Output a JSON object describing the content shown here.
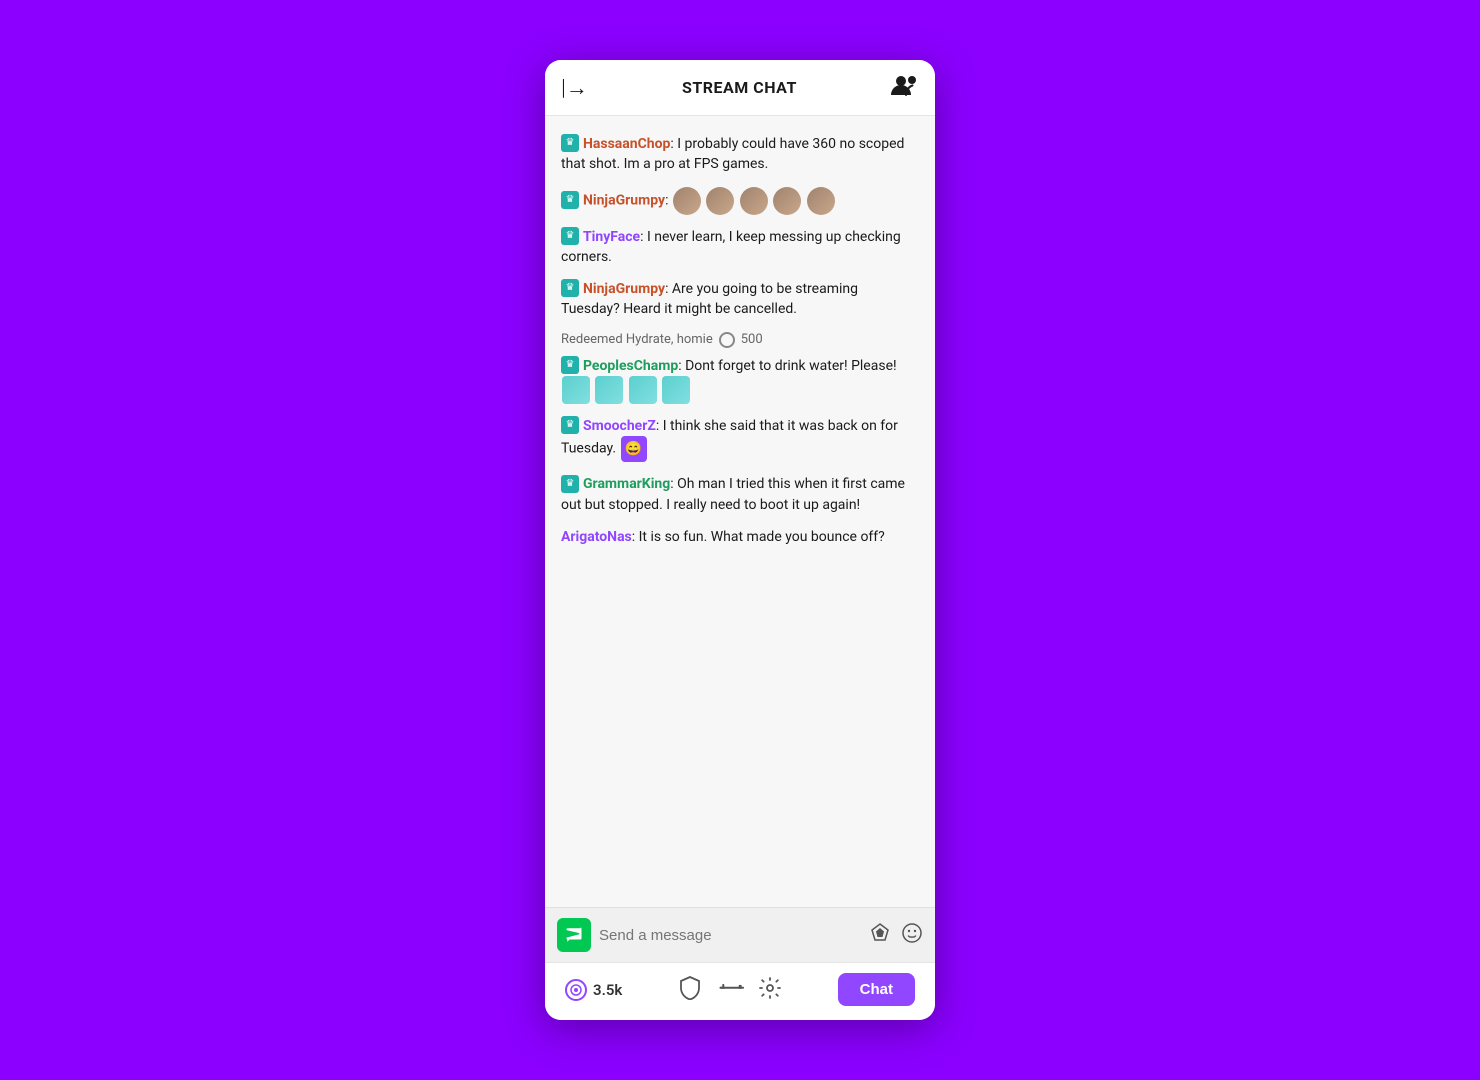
{
  "header": {
    "title": "STREAM CHAT",
    "back_icon": "→",
    "users_icon": "👥"
  },
  "messages": [
    {
      "id": 1,
      "username": "HassaanChop",
      "username_color": "orange",
      "has_badge": true,
      "text": ": I probably could have 360 no scoped that shot. Im a pro at FPS games.",
      "has_emotes": false
    },
    {
      "id": 2,
      "username": "NinjaGrumpy",
      "username_color": "orange",
      "has_badge": true,
      "text": ":",
      "has_emotes": true,
      "emote_type": "face",
      "emote_count": 5
    },
    {
      "id": 3,
      "username": "TinyFace",
      "username_color": "purple",
      "has_badge": true,
      "text": ": I never learn, I keep messing up checking corners.",
      "has_emotes": false
    },
    {
      "id": 4,
      "username": "NinjaGrumpy",
      "username_color": "orange",
      "has_badge": true,
      "text": ": Are you going to be streaming Tuesday? Heard it might be cancelled.",
      "has_emotes": false
    }
  ],
  "redemption": {
    "text": "Redeemed Hydrate, homie",
    "points": "500"
  },
  "messages2": [
    {
      "id": 5,
      "username": "PeoplesChamp",
      "username_color": "green",
      "has_badge": true,
      "text": ": Dont forget to drink water! Please!",
      "has_emotes": true,
      "emote_type": "hydrate",
      "emote_count": 4
    },
    {
      "id": 6,
      "username": "SmoocherZ",
      "username_color": "purple",
      "has_badge": true,
      "text": ": I think she said that it was back on for Tuesday.",
      "has_emotes": true,
      "emote_type": "smiling-purple",
      "emote_count": 1
    },
    {
      "id": 7,
      "username": "GrammarKing",
      "username_color": "green",
      "has_badge": true,
      "text": ": Oh man I tried this when it first came out but stopped. I really need to boot it up again!",
      "has_emotes": false
    },
    {
      "id": 8,
      "username": "ArigatoNas",
      "username_color": "purple",
      "has_badge": false,
      "text": ": It is so fun. What made you bounce off?",
      "has_emotes": false
    }
  ],
  "input": {
    "placeholder": "Send a message"
  },
  "bottom_bar": {
    "viewer_count": "3.5k",
    "chat_label": "Chat"
  }
}
